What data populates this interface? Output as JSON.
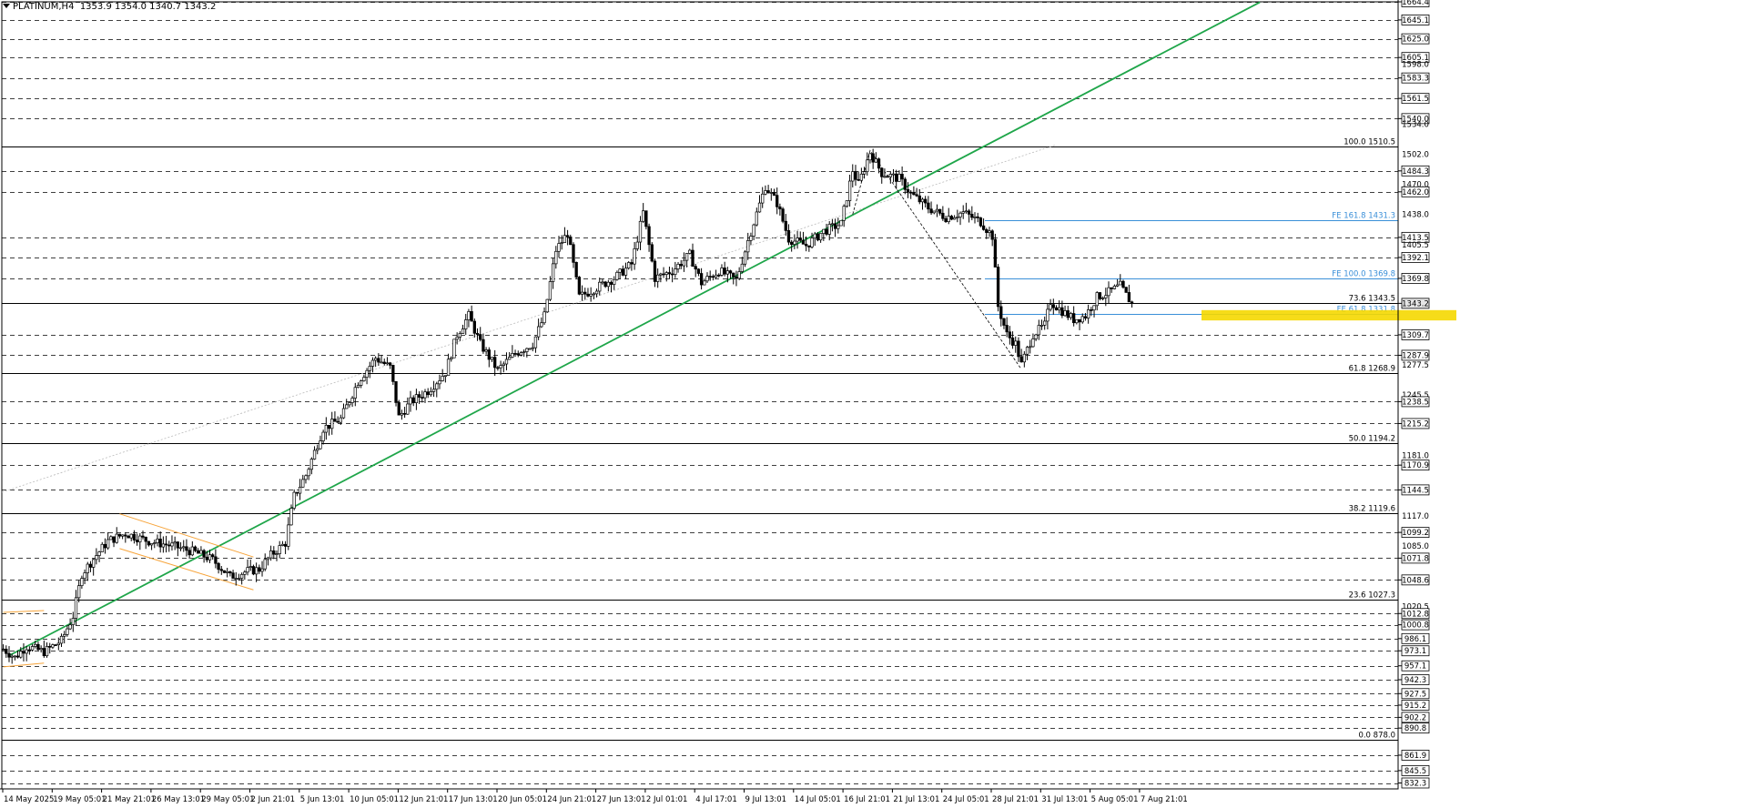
{
  "header": {
    "symbol": "PLATINUM,H4",
    "ohlc": "1353.9 1354.0 1340.7 1343.2"
  },
  "chart_data": {
    "type": "candlestick",
    "symbol": "PLATINUM",
    "timeframe": "H4",
    "ylim": [
      826.0,
      1664.4
    ],
    "grid": true,
    "y_axis_labels": [
      {
        "value": 1664.4,
        "text": "1664.4",
        "boxed": true
      },
      {
        "value": 1645.1,
        "text": "1645.1",
        "boxed": true
      },
      {
        "value": 1625.0,
        "text": "1625.0",
        "boxed": true
      },
      {
        "value": 1605.1,
        "text": "1605.1",
        "boxed": true
      },
      {
        "value": 1598.0,
        "text": "1598.0",
        "boxed": false
      },
      {
        "value": 1583.3,
        "text": "1583.3",
        "boxed": true
      },
      {
        "value": 1561.5,
        "text": "1561.5",
        "boxed": true
      },
      {
        "value": 1540.0,
        "text": "1540.0",
        "boxed": true
      },
      {
        "value": 1534.0,
        "text": "1534.0",
        "boxed": false
      },
      {
        "value": 1502.0,
        "text": "1502.0",
        "boxed": false
      },
      {
        "value": 1484.3,
        "text": "1484.3",
        "boxed": true
      },
      {
        "value": 1470.0,
        "text": "1470.0",
        "boxed": false
      },
      {
        "value": 1462.0,
        "text": "1462.0",
        "boxed": true
      },
      {
        "value": 1438.0,
        "text": "1438.0",
        "boxed": false
      },
      {
        "value": 1413.5,
        "text": "1413.5",
        "boxed": true
      },
      {
        "value": 1405.5,
        "text": "1405.5",
        "boxed": false
      },
      {
        "value": 1392.1,
        "text": "1392.1",
        "boxed": true
      },
      {
        "value": 1369.8,
        "text": "1369.8",
        "boxed": true
      },
      {
        "value": 1343.2,
        "text": "1343.2",
        "boxed": true,
        "current": true
      },
      {
        "value": 1309.7,
        "text": "1309.7",
        "boxed": true
      },
      {
        "value": 1287.9,
        "text": "1287.9",
        "boxed": true
      },
      {
        "value": 1277.5,
        "text": "1277.5",
        "boxed": false
      },
      {
        "value": 1245.5,
        "text": "1245.5",
        "boxed": false
      },
      {
        "value": 1238.5,
        "text": "1238.5",
        "boxed": true
      },
      {
        "value": 1215.2,
        "text": "1215.2",
        "boxed": true
      },
      {
        "value": 1181.0,
        "text": "1181.0",
        "boxed": false
      },
      {
        "value": 1170.9,
        "text": "1170.9",
        "boxed": true
      },
      {
        "value": 1144.5,
        "text": "1144.5",
        "boxed": true
      },
      {
        "value": 1117.0,
        "text": "1117.0",
        "boxed": false
      },
      {
        "value": 1099.2,
        "text": "1099.2",
        "boxed": true
      },
      {
        "value": 1085.0,
        "text": "1085.0",
        "boxed": false
      },
      {
        "value": 1071.8,
        "text": "1071.8",
        "boxed": true
      },
      {
        "value": 1048.6,
        "text": "1048.6",
        "boxed": true
      },
      {
        "value": 1020.5,
        "text": "1020.5",
        "boxed": false
      },
      {
        "value": 1012.8,
        "text": "1012.8",
        "boxed": true
      },
      {
        "value": 1000.8,
        "text": "1000.8",
        "boxed": true
      },
      {
        "value": 986.1,
        "text": "986.1",
        "boxed": true
      },
      {
        "value": 973.1,
        "text": "973.1",
        "boxed": true
      },
      {
        "value": 957.1,
        "text": "957.1",
        "boxed": true
      },
      {
        "value": 942.3,
        "text": "942.3",
        "boxed": true
      },
      {
        "value": 927.5,
        "text": "927.5",
        "boxed": true
      },
      {
        "value": 915.2,
        "text": "915.2",
        "boxed": true
      },
      {
        "value": 902.2,
        "text": "902.2",
        "boxed": true
      },
      {
        "value": 890.8,
        "text": "890.8",
        "boxed": true
      },
      {
        "value": 861.9,
        "text": "861.9",
        "boxed": true
      },
      {
        "value": 845.5,
        "text": "845.5",
        "boxed": true
      },
      {
        "value": 832.3,
        "text": "832.3",
        "boxed": true
      }
    ],
    "x_axis_labels": [
      "14 May 2025",
      "19 May 05:01",
      "21 May 21:01",
      "26 May 13:01",
      "29 May 05:01",
      "2 Jun 21:01",
      "5 Jun 13:01",
      "10 Jun 05:01",
      "12 Jun 21:01",
      "17 Jun 13:01",
      "20 Jun 05:01",
      "24 Jun 21:01",
      "27 Jun 13:01",
      "2 Jul 01:01",
      "4 Jul 17:01",
      "9 Jul 13:01",
      "14 Jul 05:01",
      "16 Jul 21:01",
      "21 Jul 13:01",
      "24 Jul 05:01",
      "28 Jul 21:01",
      "31 Jul 13:01",
      "5 Aug 05:01",
      "7 Aug 21:01"
    ],
    "fibonacci_levels": [
      {
        "level": "100.0",
        "value": 1510.5,
        "label": "100.0 1510.5"
      },
      {
        "level": "73.6",
        "value": 1343.5,
        "label": "73.6 1343.5"
      },
      {
        "level": "61.8",
        "value": 1268.9,
        "label": "61.8 1268.9"
      },
      {
        "level": "50.0",
        "value": 1194.2,
        "label": "50.0 1194.2"
      },
      {
        "level": "38.2",
        "value": 1119.6,
        "label": "38.2 1119.6"
      },
      {
        "level": "23.6",
        "value": 1027.3,
        "label": "23.6 1027.3"
      },
      {
        "level": "0.0",
        "value": 878.0,
        "label": "0.0 878.0"
      }
    ],
    "fibonacci_expansion": [
      {
        "level": "161.8",
        "value": 1431.3,
        "label": "FE 161.8 1431.3"
      },
      {
        "level": "100.0",
        "value": 1369.8,
        "label": "FE 100.0 1369.8"
      },
      {
        "level": "61.8",
        "value": 1331.8,
        "label": "FE 61.8 1331.8"
      }
    ],
    "highlight_zone": {
      "from": 1325.0,
      "to": 1336.0,
      "color": "#f5d800"
    },
    "trendline": {
      "color": "#1fa64a",
      "from": {
        "bar": 2,
        "price": 968.0
      },
      "to": {
        "bar": 432,
        "price": 1664.0
      }
    },
    "channel": {
      "color": "#f7a43a",
      "upper": [
        {
          "bar": 40,
          "price": 1119.0
        },
        {
          "bar": 86,
          "price": 1073.0
        }
      ],
      "lower": [
        {
          "bar": 40,
          "price": 1082.0
        },
        {
          "bar": 86,
          "price": 1038.0
        }
      ]
    },
    "start_channel": {
      "color": "#f7a43a",
      "upper": [
        {
          "bar": 0,
          "price": 1014.0
        },
        {
          "bar": 14,
          "price": 1016.0
        }
      ],
      "lower": [
        {
          "bar": 0,
          "price": 956.0
        },
        {
          "bar": 14,
          "price": 960.0
        }
      ]
    },
    "current_price": 1343.2,
    "swing_path": [
      {
        "bar": 292,
        "price": 1438.0
      },
      {
        "bar": 298,
        "price": 1506.0
      },
      {
        "bar": 350,
        "price": 1273.0
      }
    ],
    "price_path": [
      {
        "bar": 0,
        "price": 975.0
      },
      {
        "bar": 4,
        "price": 966.0
      },
      {
        "bar": 8,
        "price": 978.0
      },
      {
        "bar": 14,
        "price": 972.0
      },
      {
        "bar": 20,
        "price": 984.0
      },
      {
        "bar": 24,
        "price": 1010.0
      },
      {
        "bar": 27,
        "price": 1055.0
      },
      {
        "bar": 32,
        "price": 1075.0
      },
      {
        "bar": 36,
        "price": 1090.0
      },
      {
        "bar": 42,
        "price": 1098.0
      },
      {
        "bar": 50,
        "price": 1090.0
      },
      {
        "bar": 58,
        "price": 1085.0
      },
      {
        "bar": 66,
        "price": 1078.0
      },
      {
        "bar": 72,
        "price": 1070.0
      },
      {
        "bar": 78,
        "price": 1052.0
      },
      {
        "bar": 84,
        "price": 1058.0
      },
      {
        "bar": 88,
        "price": 1060.0
      },
      {
        "bar": 92,
        "price": 1075.0
      },
      {
        "bar": 97,
        "price": 1088.0
      },
      {
        "bar": 100,
        "price": 1138.0
      },
      {
        "bar": 104,
        "price": 1160.0
      },
      {
        "bar": 110,
        "price": 1210.0
      },
      {
        "bar": 116,
        "price": 1220.0
      },
      {
        "bar": 122,
        "price": 1260.0
      },
      {
        "bar": 128,
        "price": 1285.0
      },
      {
        "bar": 133,
        "price": 1275.0
      },
      {
        "bar": 136,
        "price": 1222.0
      },
      {
        "bar": 140,
        "price": 1238.0
      },
      {
        "bar": 146,
        "price": 1250.0
      },
      {
        "bar": 152,
        "price": 1270.0
      },
      {
        "bar": 156,
        "price": 1310.0
      },
      {
        "bar": 160,
        "price": 1330.0
      },
      {
        "bar": 164,
        "price": 1300.0
      },
      {
        "bar": 170,
        "price": 1272.0
      },
      {
        "bar": 176,
        "price": 1290.0
      },
      {
        "bar": 182,
        "price": 1300.0
      },
      {
        "bar": 186,
        "price": 1330.0
      },
      {
        "bar": 190,
        "price": 1400.0
      },
      {
        "bar": 194,
        "price": 1418.0
      },
      {
        "bar": 198,
        "price": 1350.0
      },
      {
        "bar": 204,
        "price": 1360.0
      },
      {
        "bar": 210,
        "price": 1370.0
      },
      {
        "bar": 216,
        "price": 1385.0
      },
      {
        "bar": 220,
        "price": 1440.0
      },
      {
        "bar": 224,
        "price": 1370.0
      },
      {
        "bar": 230,
        "price": 1378.0
      },
      {
        "bar": 236,
        "price": 1395.0
      },
      {
        "bar": 240,
        "price": 1365.0
      },
      {
        "bar": 246,
        "price": 1378.0
      },
      {
        "bar": 252,
        "price": 1368.0
      },
      {
        "bar": 256,
        "price": 1410.0
      },
      {
        "bar": 262,
        "price": 1468.0
      },
      {
        "bar": 266,
        "price": 1450.0
      },
      {
        "bar": 270,
        "price": 1412.0
      },
      {
        "bar": 276,
        "price": 1405.0
      },
      {
        "bar": 282,
        "price": 1420.0
      },
      {
        "bar": 288,
        "price": 1428.0
      },
      {
        "bar": 292,
        "price": 1485.0
      },
      {
        "bar": 294,
        "price": 1470.0
      },
      {
        "bar": 298,
        "price": 1504.0
      },
      {
        "bar": 302,
        "price": 1482.0
      },
      {
        "bar": 308,
        "price": 1476.0
      },
      {
        "bar": 312,
        "price": 1460.0
      },
      {
        "bar": 318,
        "price": 1445.0
      },
      {
        "bar": 324,
        "price": 1435.0
      },
      {
        "bar": 330,
        "price": 1440.0
      },
      {
        "bar": 336,
        "price": 1430.0
      },
      {
        "bar": 340,
        "price": 1415.0
      },
      {
        "bar": 342,
        "price": 1340.0
      },
      {
        "bar": 345,
        "price": 1310.0
      },
      {
        "bar": 348,
        "price": 1300.0
      },
      {
        "bar": 350,
        "price": 1278.0
      },
      {
        "bar": 354,
        "price": 1310.0
      },
      {
        "bar": 358,
        "price": 1320.0
      },
      {
        "bar": 360,
        "price": 1345.0
      },
      {
        "bar": 364,
        "price": 1335.0
      },
      {
        "bar": 368,
        "price": 1326.0
      },
      {
        "bar": 372,
        "price": 1330.0
      },
      {
        "bar": 376,
        "price": 1350.0
      },
      {
        "bar": 380,
        "price": 1355.0
      },
      {
        "bar": 384,
        "price": 1362.0
      },
      {
        "bar": 386,
        "price": 1352.0
      },
      {
        "bar": 388,
        "price": 1343.0
      }
    ]
  }
}
